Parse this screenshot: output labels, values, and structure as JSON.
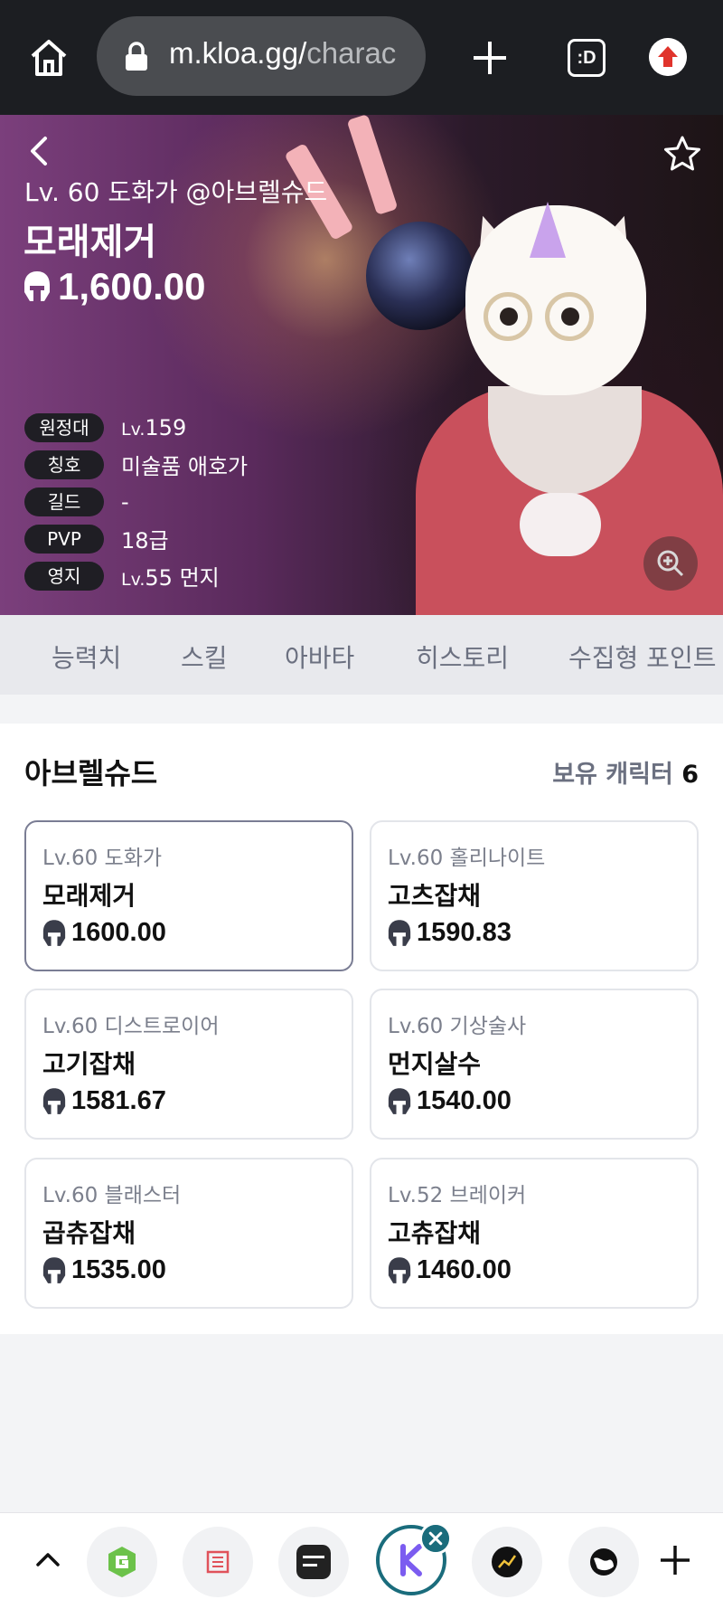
{
  "browser": {
    "url_main": "m.kloa.gg/",
    "url_rest": "charac",
    "tabs_label": ":D"
  },
  "hero": {
    "subtitle": "Lv. 60 도화가 @아브렐슈드",
    "name": "모래제거",
    "item_level": "1,600.00",
    "info": [
      {
        "badge": "원정대",
        "prefix": "Lv.",
        "value": "159"
      },
      {
        "badge": "칭호",
        "prefix": "",
        "value": "미술품 애호가"
      },
      {
        "badge": "길드",
        "prefix": "",
        "value": "-"
      },
      {
        "badge": "PVP",
        "prefix": "",
        "value": "18급"
      },
      {
        "badge": "영지",
        "prefix": "Lv.",
        "value": "55 먼지"
      }
    ]
  },
  "tabs": [
    "능력치",
    "스킬",
    "아바타",
    "히스토리",
    "수집형 포인트"
  ],
  "roster": {
    "server": "아브렐슈드",
    "count_label": "보유 캐릭터",
    "count": "6",
    "characters": [
      {
        "sub": "Lv.60 도화가",
        "name": "모래제거",
        "level": "1600.00",
        "active": true
      },
      {
        "sub": "Lv.60 홀리나이트",
        "name": "고츠잡채",
        "level": "1590.83",
        "active": false
      },
      {
        "sub": "Lv.60 디스트로이어",
        "name": "고기잡채",
        "level": "1581.67",
        "active": false
      },
      {
        "sub": "Lv.60 기상술사",
        "name": "먼지살수",
        "level": "1540.00",
        "active": false
      },
      {
        "sub": "Lv.60 블래스터",
        "name": "곱츄잡채",
        "level": "1535.00",
        "active": false
      },
      {
        "sub": "Lv.52 브레이커",
        "name": "고츄잡채",
        "level": "1460.00",
        "active": false
      }
    ]
  },
  "bottom_bar": {
    "apps": [
      "green-g-app",
      "red-stamp-app",
      "kloa-gg-app",
      "k-app",
      "chart-app",
      "globe-app"
    ],
    "kloa_label": "KLOA.\nGG",
    "k_label": "K"
  },
  "colors": {
    "hero_bg": "#5a2a5c",
    "active_border": "#7a7d94",
    "accent_teal": "#1a6c7c",
    "k_purple": "#7b5cf0"
  }
}
